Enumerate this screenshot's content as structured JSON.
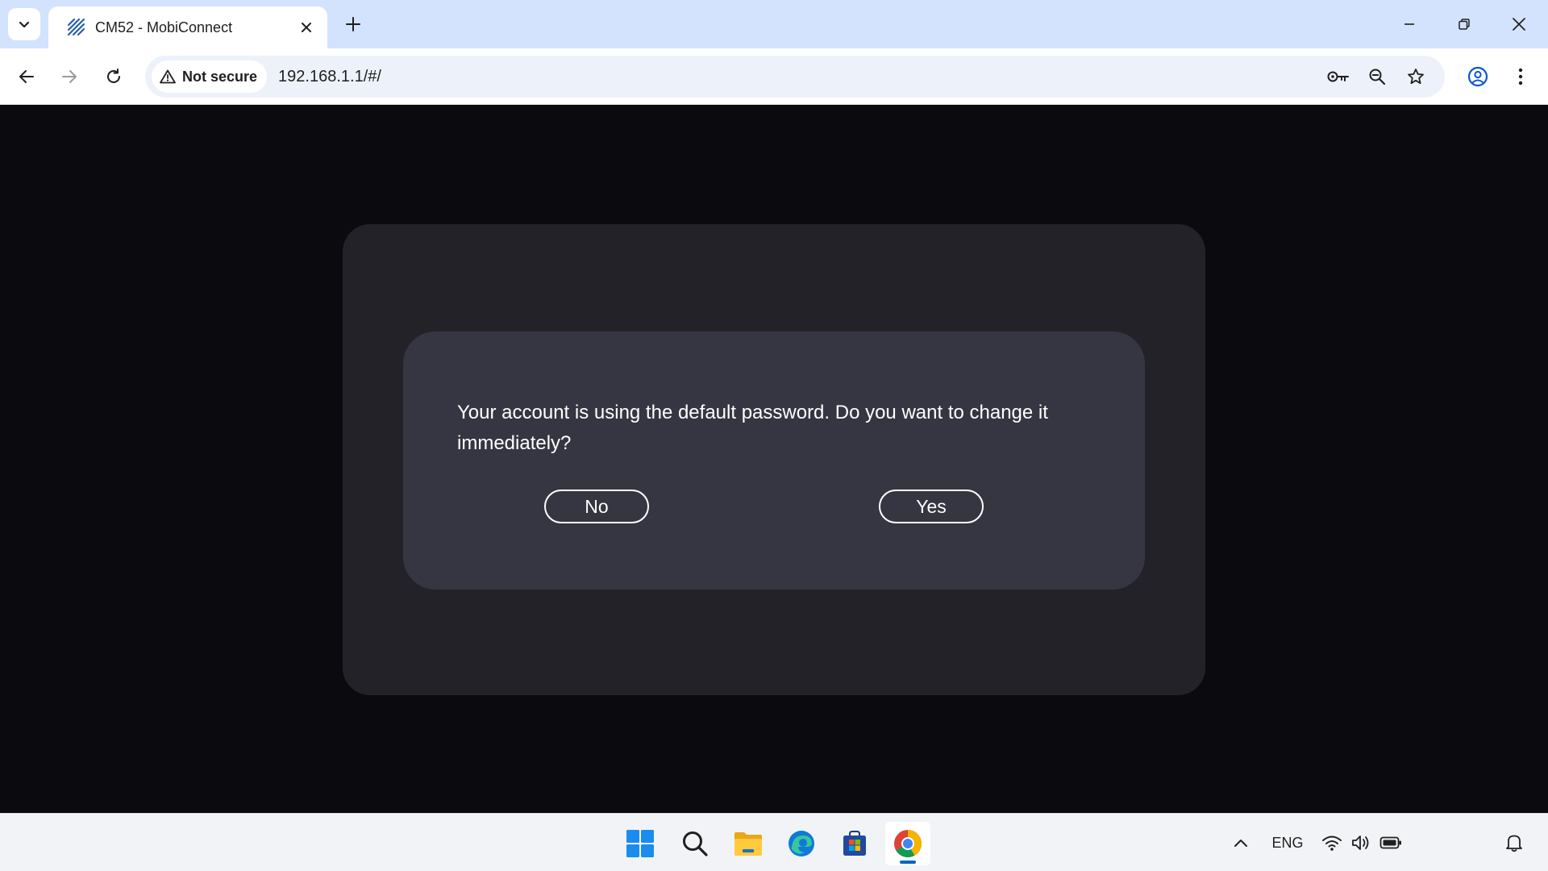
{
  "browser": {
    "tab_title": "CM52 - MobiConnect",
    "security_label": "Not secure",
    "url": "192.168.1.1/#/"
  },
  "dialog": {
    "message": "Your account is using the default password. Do you want to change it immediately?",
    "no_label": "No",
    "yes_label": "Yes"
  },
  "taskbar": {
    "language": "ENG",
    "apps": [
      "start-icon",
      "search-icon",
      "file-explorer-icon",
      "edge-icon",
      "microsoft-store-icon",
      "chrome-icon"
    ]
  },
  "colors": {
    "page_bg": "#0b0b0f",
    "outer_card": "#222228",
    "dialog_bg": "#363642",
    "tabstrip": "#d3e3fd",
    "omnibox": "#edf2fa",
    "accent": "#0067c0"
  }
}
